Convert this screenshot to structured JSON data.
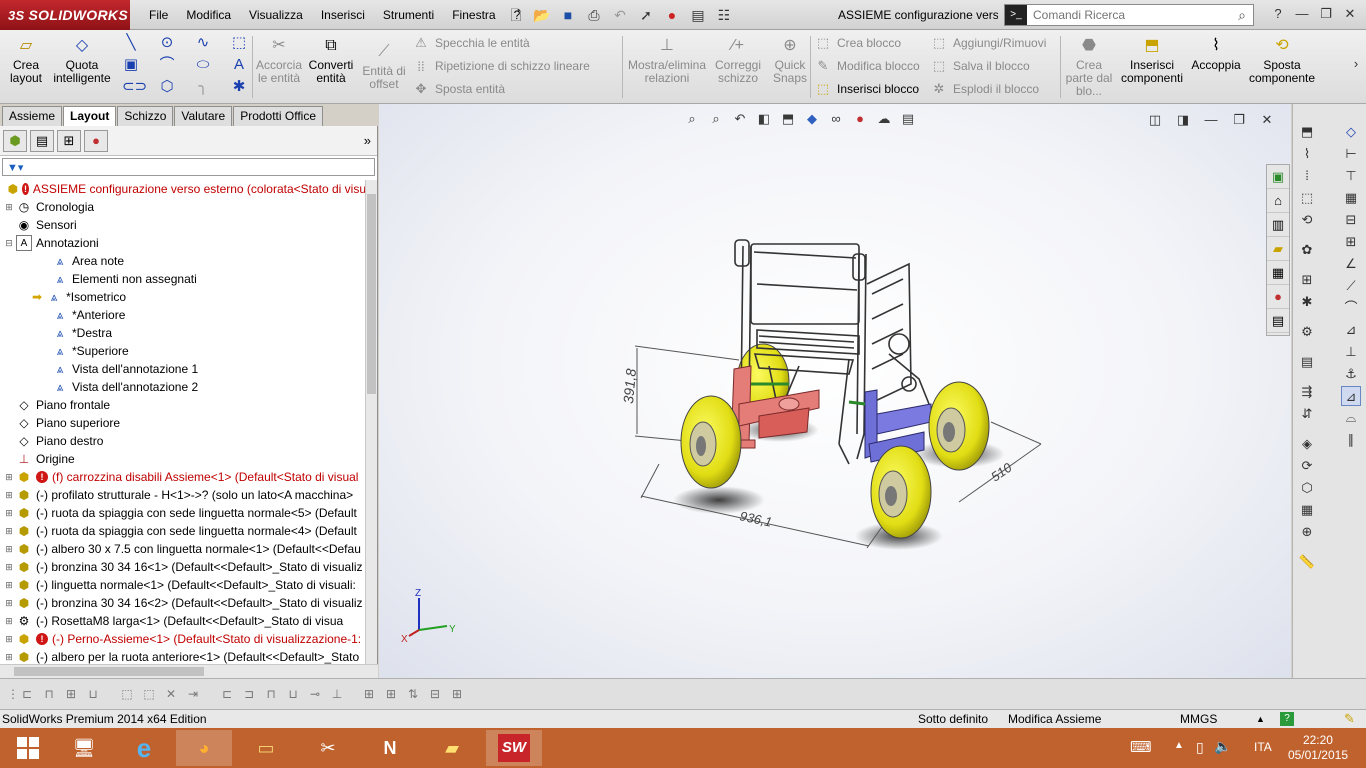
{
  "app": {
    "logo_text": "SOLIDWORKS",
    "logo_prefix": "3S"
  },
  "menu": [
    "File",
    "Modifica",
    "Visualizza",
    "Inserisci",
    "Strumenti",
    "Finestra",
    "?"
  ],
  "document_title": "ASSIEME configurazione vers...",
  "search": {
    "placeholder": "Comandi Ricerca",
    "term_icon": "terminal-icon",
    "icon": "search-icon"
  },
  "command_manager": {
    "crea_layout": "Crea layout",
    "quota_intelligente": "Quota intelligente",
    "accorcia_entita": "Accorcia le entità",
    "converti_entita": "Converti entità",
    "entita_offset": "Entità di offset",
    "specchia": "Specchia le entità",
    "ripetizione": "Ripetizione di schizzo lineare",
    "sposta_entita": "Sposta entità",
    "mostra_relazioni": "Mostra/elimina relazioni",
    "correggi_schizzo": "Correggi schizzo",
    "quick_snaps": "Quick Snaps",
    "crea_blocco": "Crea blocco",
    "modifica_blocco": "Modifica blocco",
    "inserisci_blocco": "Inserisci blocco",
    "aggiungi_rimuovi": "Aggiungi/Rimuovi",
    "salva_blocco": "Salva il blocco",
    "esplodi_blocco": "Esplodi il blocco",
    "crea_parte": "Crea parte dal blo...",
    "inserisci_componenti": "Inserisci componenti",
    "accoppia": "Accoppia",
    "sposta_componente": "Sposta componente"
  },
  "tabs": [
    {
      "label": "Assieme",
      "active": false
    },
    {
      "label": "Layout",
      "active": true
    },
    {
      "label": "Schizzo",
      "active": false
    },
    {
      "label": "Valutare",
      "active": false
    },
    {
      "label": "Prodotti Office",
      "active": false
    }
  ],
  "tree": [
    {
      "label": "ASSIEME configurazione verso esterno  (colorata<Stato di visu",
      "level": 0,
      "icon": "assembly-icon",
      "error": true,
      "red": true,
      "expand": ""
    },
    {
      "label": "Cronologia",
      "level": 1,
      "icon": "history-icon",
      "expand": "+"
    },
    {
      "label": "Sensori",
      "level": 1,
      "icon": "sensor-icon",
      "expand": ""
    },
    {
      "label": "Annotazioni",
      "level": 1,
      "icon": "annotation-icon",
      "expand": "−"
    },
    {
      "label": "Area note",
      "level": 3,
      "icon": "annotation-view-icon",
      "expand": ""
    },
    {
      "label": "Elementi non assegnati",
      "level": 3,
      "icon": "annotation-view-icon",
      "expand": ""
    },
    {
      "label": "*Isometrico",
      "level": 3,
      "icon": "annotation-view-icon",
      "expand": "",
      "arrow": true
    },
    {
      "label": "*Anteriore",
      "level": 3,
      "icon": "annotation-view-icon",
      "expand": ""
    },
    {
      "label": "*Destra",
      "level": 3,
      "icon": "annotation-view-icon",
      "expand": ""
    },
    {
      "label": "*Superiore",
      "level": 3,
      "icon": "annotation-view-icon",
      "expand": ""
    },
    {
      "label": "Vista dell'annotazione  1",
      "level": 3,
      "icon": "annotation-view-icon",
      "expand": ""
    },
    {
      "label": "Vista dell'annotazione  2",
      "level": 3,
      "icon": "annotation-view-icon",
      "expand": ""
    },
    {
      "label": "Piano frontale",
      "level": 1,
      "icon": "plane-icon",
      "expand": ""
    },
    {
      "label": "Piano superiore",
      "level": 1,
      "icon": "plane-icon",
      "expand": ""
    },
    {
      "label": "Piano destro",
      "level": 1,
      "icon": "plane-icon",
      "expand": ""
    },
    {
      "label": "Origine",
      "level": 1,
      "icon": "origin-icon",
      "expand": ""
    },
    {
      "label": "(f) carrozzina disabili Assieme<1> (Default<Stato di visual",
      "level": 1,
      "icon": "assembly-icon",
      "error": true,
      "red": true,
      "expand": "+"
    },
    {
      "label": "(-) profilato strutturale - H<1>->? (solo un lato<A macchina>",
      "level": 1,
      "icon": "part-icon",
      "expand": "+"
    },
    {
      "label": "(-) ruota da spiaggia con sede linguetta normale<5> (Default",
      "level": 1,
      "icon": "part-icon",
      "expand": "+"
    },
    {
      "label": "(-) ruota da spiaggia con sede linguetta normale<4> (Default",
      "level": 1,
      "icon": "part-icon",
      "expand": "+"
    },
    {
      "label": "(-) albero 30 x 7.5 con linguetta normale<1> (Default<<Defau",
      "level": 1,
      "icon": "part-icon",
      "expand": "+"
    },
    {
      "label": "(-) bronzina 30 34 16<1> (Default<<Default>_Stato di visualiz",
      "level": 1,
      "icon": "part-icon",
      "expand": "+"
    },
    {
      "label": "(-) linguetta normale<1> (Default<<Default>_Stato di visuali:",
      "level": 1,
      "icon": "part-icon",
      "expand": "+"
    },
    {
      "label": "(-) bronzina 30 34 16<2> (Default<<Default>_Stato di visualiz",
      "level": 1,
      "icon": "part-icon",
      "expand": "+"
    },
    {
      "label": "(-) RosettaM8 larga<1> (Default<<Default>_Stato di visua",
      "level": 1,
      "icon": "toolbox-part-icon",
      "expand": "+"
    },
    {
      "label": "(-) Perno-Assieme<1> (Default<Stato di visualizzazione-1:",
      "level": 1,
      "icon": "assembly-icon",
      "error": true,
      "red": true,
      "expand": "+"
    },
    {
      "label": "(-) albero per la ruota anteriore<1> (Default<<Default>_Stato",
      "level": 1,
      "icon": "part-icon",
      "expand": "+"
    }
  ],
  "dimensions": {
    "height": "391,8",
    "length": "936,1",
    "width": "510"
  },
  "triad": {
    "x": "X",
    "y": "Y",
    "z": "Z"
  },
  "status": {
    "edition": "SolidWorks Premium 2014 x64 Edition",
    "state": "Sotto definito",
    "mode": "Modifica Assieme",
    "units": "MMGS",
    "help": "?"
  },
  "taskbar": {
    "apps": [
      "windows-start-icon",
      "remote-desktop-icon",
      "internet-explorer-icon",
      "firefox-icon",
      "file-explorer-icon",
      "snipping-tool-icon",
      "onenote-icon",
      "sticky-notes-icon",
      "solidworks-icon"
    ],
    "language": "ITA",
    "time": "22:20",
    "date": "05/01/2015"
  }
}
